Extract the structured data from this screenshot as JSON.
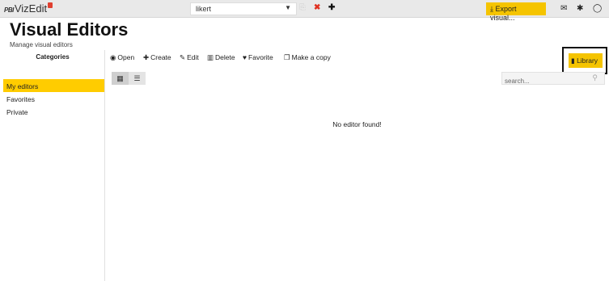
{
  "topbar": {
    "logo_prefix": "PBI",
    "logo_text": "VizEdit",
    "selector_value": "likert",
    "export_label": "Export visual..."
  },
  "header": {
    "title": "Visual Editors",
    "subtitle": "Manage visual editors"
  },
  "sidebar": {
    "title": "Categories",
    "items": [
      {
        "label": "My editors",
        "active": true
      },
      {
        "label": "Favorites"
      },
      {
        "label": "Private"
      }
    ]
  },
  "toolbar": {
    "open": "Open",
    "create": "Create",
    "edit": "Edit",
    "delete": "Delete",
    "favorite": "Favorite",
    "copy": "Make a copy",
    "library": "Library"
  },
  "search": {
    "placeholder": "search..."
  },
  "main": {
    "empty_message": "No editor found!"
  },
  "colors": {
    "accent": "#f5c400",
    "active_category": "#ffcc00",
    "close_red": "#e03020"
  }
}
